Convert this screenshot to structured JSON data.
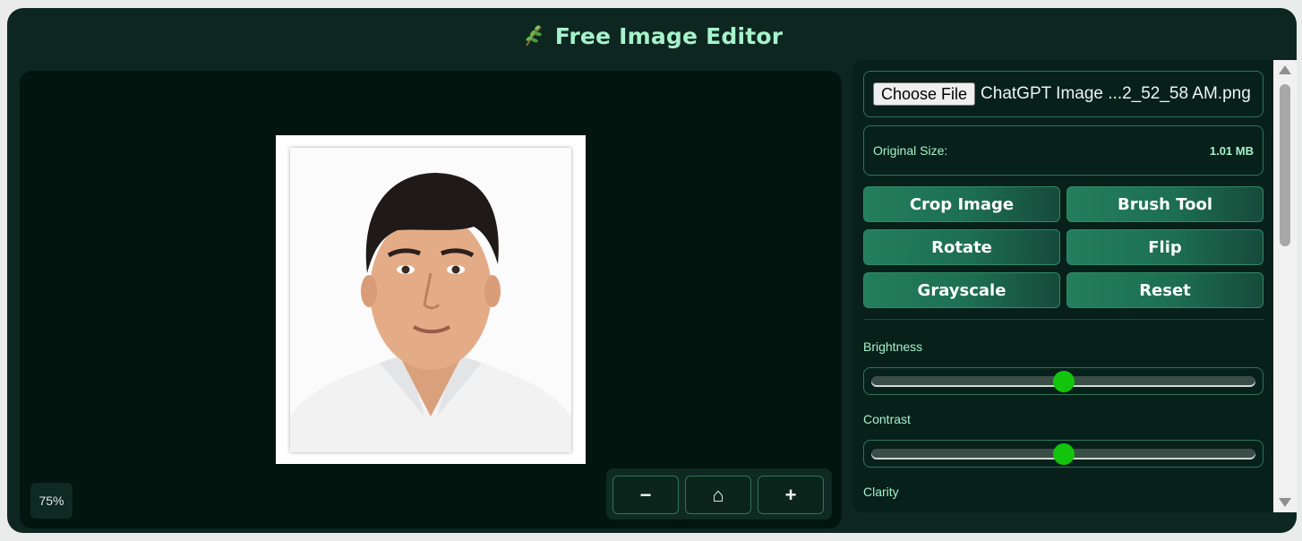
{
  "header": {
    "title": "Free Image Editor",
    "logo_icon": "herb-icon"
  },
  "canvas": {
    "zoom_label": "75%"
  },
  "zoom_controls": {
    "zoom_out": "−",
    "home": "⌂",
    "zoom_in": "+"
  },
  "sidebar": {
    "file": {
      "button_label": "Choose File",
      "file_name": "ChatGPT Image ...2_52_58 AM.png"
    },
    "size": {
      "label": "Original Size:",
      "value": "1.01 MB"
    },
    "tools": {
      "crop": "Crop Image",
      "brush": "Brush Tool",
      "rotate": "Rotate",
      "flip": "Flip",
      "grayscale": "Grayscale",
      "reset": "Reset"
    },
    "sliders": {
      "brightness": {
        "label": "Brightness",
        "value": 0.5
      },
      "contrast": {
        "label": "Contrast",
        "value": 0.5
      },
      "clarity": {
        "label": "Clarity"
      }
    }
  },
  "colors": {
    "accent": "#a6f2cc",
    "thumb": "#13c40d",
    "button": "#1d6e52",
    "background": "#0e2620"
  }
}
